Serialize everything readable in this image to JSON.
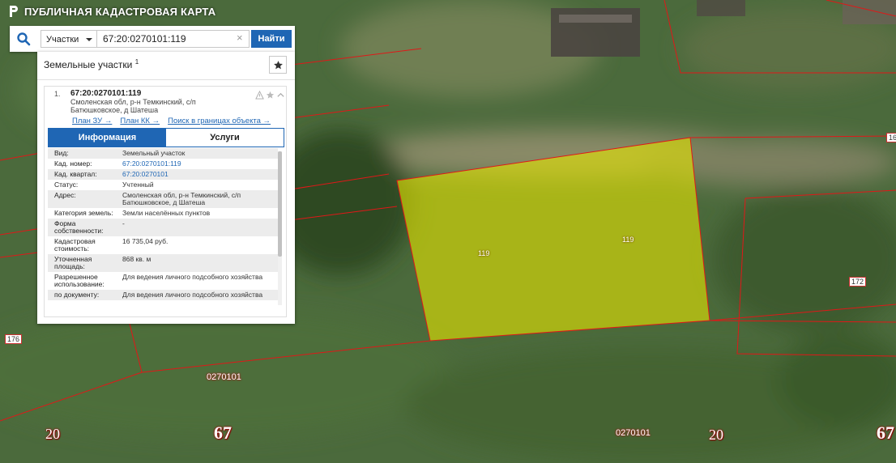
{
  "header": {
    "title": "ПУБЛИЧНАЯ КАДАСТРОВАЯ КАРТА"
  },
  "search": {
    "type_label": "Участки",
    "query": "67:20:0270101:119",
    "button_label": "Найти"
  },
  "panel": {
    "title": "Земельные участки",
    "count": "1"
  },
  "result": {
    "index": "1.",
    "cad_number": "67:20:0270101:119",
    "address": "Смоленская обл, р-н Темкинский, с/п Батюшковское, д Шатеша",
    "links": [
      "План ЗУ →",
      "План КК →",
      "Поиск в границах объекта →"
    ],
    "tabs": [
      "Информация",
      "Услуги"
    ],
    "info": [
      {
        "k": "Вид:",
        "v": "Земельный участок"
      },
      {
        "k": "Кад. номер:",
        "v": "67:20:0270101:119"
      },
      {
        "k": "Кад. квартал:",
        "v": "67:20:0270101"
      },
      {
        "k": "Статус:",
        "v": "Учтенный"
      },
      {
        "k": "Адрес:",
        "v": "Смоленская обл, р-н Темкинский, с/п Батюшковское, д Шатеша"
      },
      {
        "k": "Категория земель:",
        "v": "Земли населённых пунктов"
      },
      {
        "k": "Форма собственности:",
        "v": "-"
      },
      {
        "k": "Кадастровая стоимость:",
        "v": "16 735,04 руб."
      },
      {
        "k": "Уточненная площадь:",
        "v": "868 кв. м"
      },
      {
        "k": "Разрешенное использование:",
        "v": "Для ведения личного подсобного хозяйства"
      },
      {
        "k": "по документу:",
        "v": "Для ведения личного подсобного хозяйства"
      }
    ]
  },
  "map": {
    "labels": {
      "parcel_a": "119",
      "parcel_b": "119",
      "num_16": "16",
      "num_172": "172",
      "num_176": "176",
      "quarter_left": "0270101",
      "quarter_right": "0270101",
      "region_20_left": "20",
      "region_67_left": "67",
      "region_20_right": "20",
      "region_67_right": "67"
    }
  },
  "colors": {
    "accent": "#1f66b4",
    "parcel_fill": "#e6e600",
    "boundary": "#e01818"
  }
}
